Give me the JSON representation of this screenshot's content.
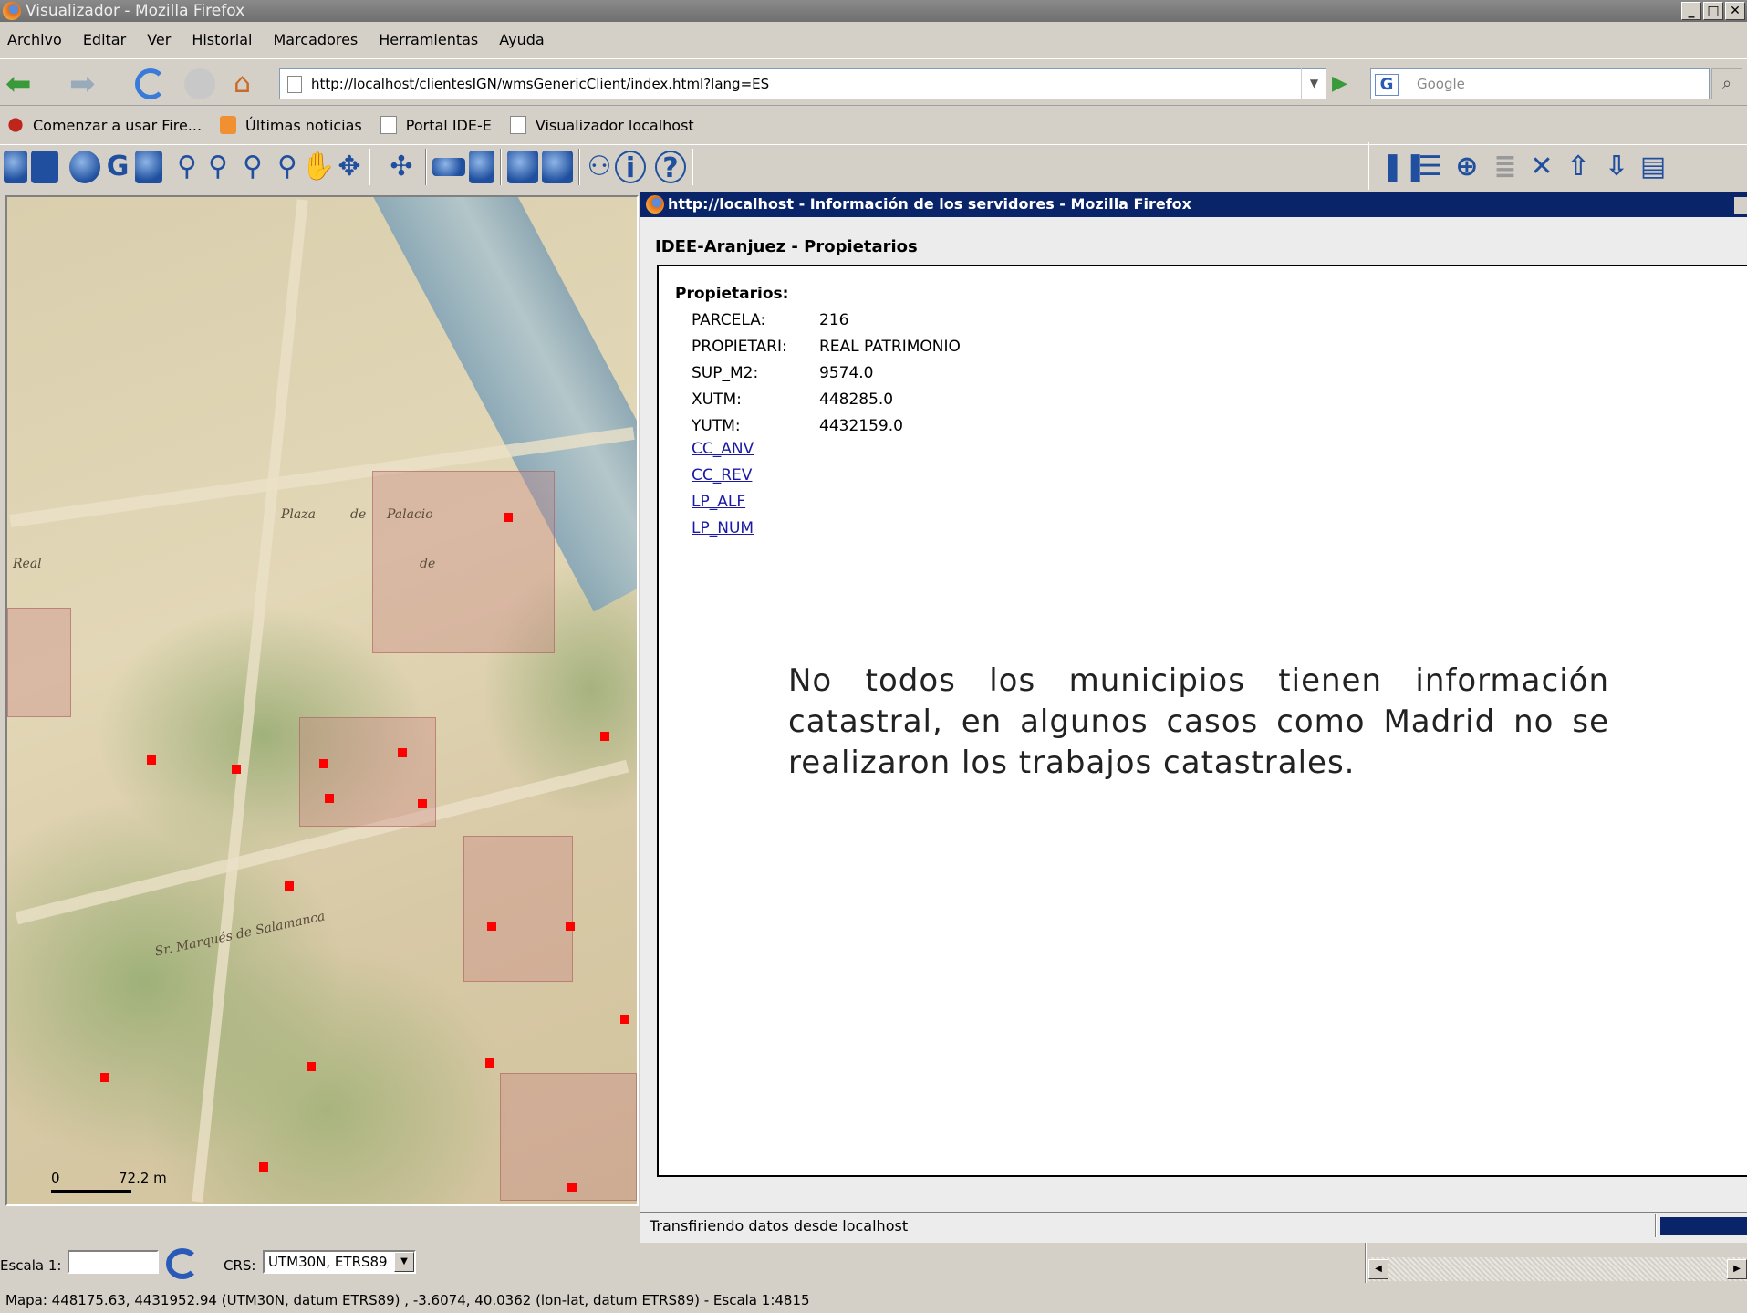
{
  "window": {
    "title": "Visualizador - Mozilla Firefox"
  },
  "menu": {
    "items": [
      "Archivo",
      "Editar",
      "Ver",
      "Historial",
      "Marcadores",
      "Herramientas",
      "Ayuda"
    ]
  },
  "address": {
    "url": "http://localhost/clientesIGN/wmsGenericClient/index.html?lang=ES",
    "search_placeholder": "Google"
  },
  "bookmarks": {
    "items": [
      "Comenzar a usar Fire...",
      "Últimas noticias",
      "Portal IDE-E",
      "Visualizador localhost"
    ]
  },
  "map": {
    "labels": [
      "Plaza",
      "de",
      "Palacio",
      "Real",
      "de",
      "Sr. Marqués de Salamanca"
    ],
    "scale_start": "0",
    "scale_end": "72.2 m",
    "marker_color": "#ff0000"
  },
  "popup": {
    "title": "http://localhost - Información de los servidores - Mozilla Firefox",
    "header": "IDEE-Aranjuez - Propietarios",
    "section": "Propietarios:",
    "rows": [
      {
        "key": "PARCELA:",
        "value": "216"
      },
      {
        "key": "PROPIETARI:",
        "value": "REAL PATRIMONIO"
      },
      {
        "key": "SUP_M2:",
        "value": "9574.0"
      },
      {
        "key": "XUTM:",
        "value": "448285.0"
      },
      {
        "key": "YUTM:",
        "value": "4432159.0"
      }
    ],
    "links": [
      "CC_ANV",
      "CC_REV",
      "LP_ALF",
      "LP_NUM"
    ],
    "note": "No todos los municipios tienen información catastral, en algunos casos como Madrid no se realizaron los trabajos catastrales.",
    "status": "Transfiriendo datos desde localhost"
  },
  "controls": {
    "scale_label": "Escala 1:",
    "crs_label": "CRS:",
    "crs_value": "UTM30N, ETRS89"
  },
  "status": {
    "text": "Mapa: 448175.63, 4431952.94 (UTM30N, datum ETRS89) , -3.6074, 40.0362 (lon-lat, datum ETRS89) - Escala 1:4815"
  },
  "colors": {
    "titlebar_active": "#0a246a",
    "link": "#1a1aa6",
    "chrome": "#d4d0c8"
  }
}
